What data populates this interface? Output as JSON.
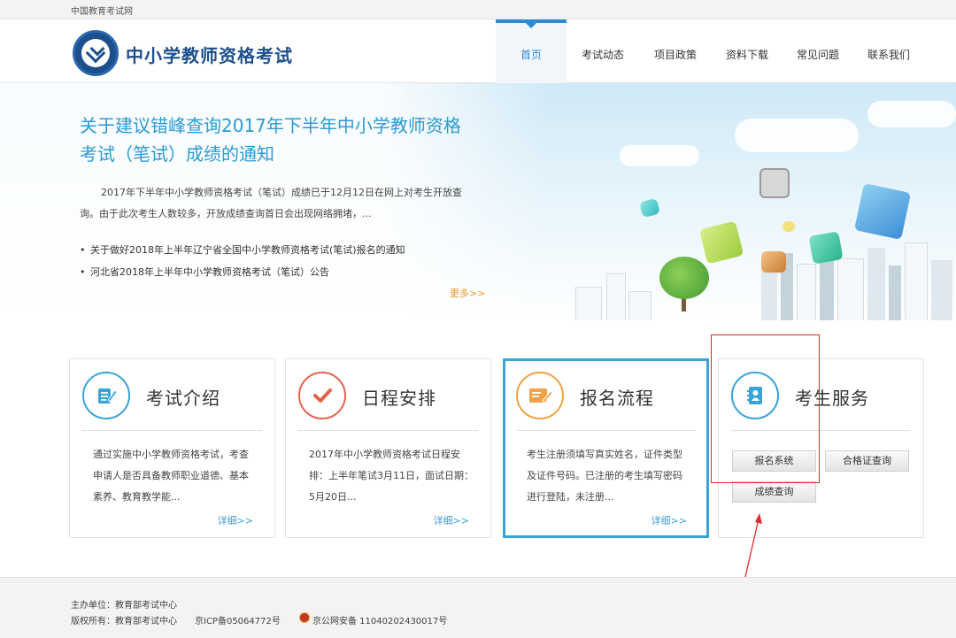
{
  "top_strip": {
    "site_link": "中国教育考试网"
  },
  "header": {
    "site_title": "中小学教师资格考试",
    "nav": [
      "首页",
      "考试动态",
      "项目政策",
      "资料下载",
      "常见问题",
      "联系我们"
    ]
  },
  "banner": {
    "headline": "关于建议错峰查询2017年下半年中小学教师资格考试（笔试）成绩的通知",
    "summary": "2017年下半年中小学教师资格考试（笔试）成绩已于12月12日在网上对考生开放查询。由于此次考生人数较多，开放成绩查询首日会出现网络拥堵，...",
    "list": [
      "关于做好2018年上半年辽宁省全国中小学教师资格考试(笔试)报名的通知",
      "河北省2018年上半年中小学教师资格考试（笔试）公告"
    ],
    "more": "更多>>"
  },
  "cards": [
    {
      "title": "考试介绍",
      "icon": "document-edit-icon",
      "text": "通过实施中小学教师资格考试，考查申请人是否具备教师职业道德、基本素养、教育教学能...",
      "more": "详细>>"
    },
    {
      "title": "日程安排",
      "icon": "checkmark-icon",
      "text": "2017年中小学教师资格考试日程安排：上半年笔试3月11日，面试日期：5月20日...",
      "more": "详细>>"
    },
    {
      "title": "报名流程",
      "icon": "form-pen-icon",
      "text": "考生注册须填写真实姓名，证件类型及证件号码。已注册的考生填写密码进行登陆，未注册...",
      "more": "详细>>"
    },
    {
      "title": "考生服务",
      "icon": "contact-book-icon",
      "buttons": [
        "报名系统",
        "合格证查询",
        "成绩查询"
      ]
    }
  ],
  "footer": {
    "sponsor": "主办单位：教育部考试中心",
    "copyright": "版权所有：教育部考试中心",
    "icp": "京ICP备05064772号",
    "police": "京公网安备 11040202430017号"
  },
  "colors": {
    "brand_blue": "#1d4f8c",
    "accent_blue": "#2a9ad6",
    "card_highlight": "#3aa3d8",
    "annotation_red": "#e22c2c",
    "more_orange": "#e8962a"
  }
}
